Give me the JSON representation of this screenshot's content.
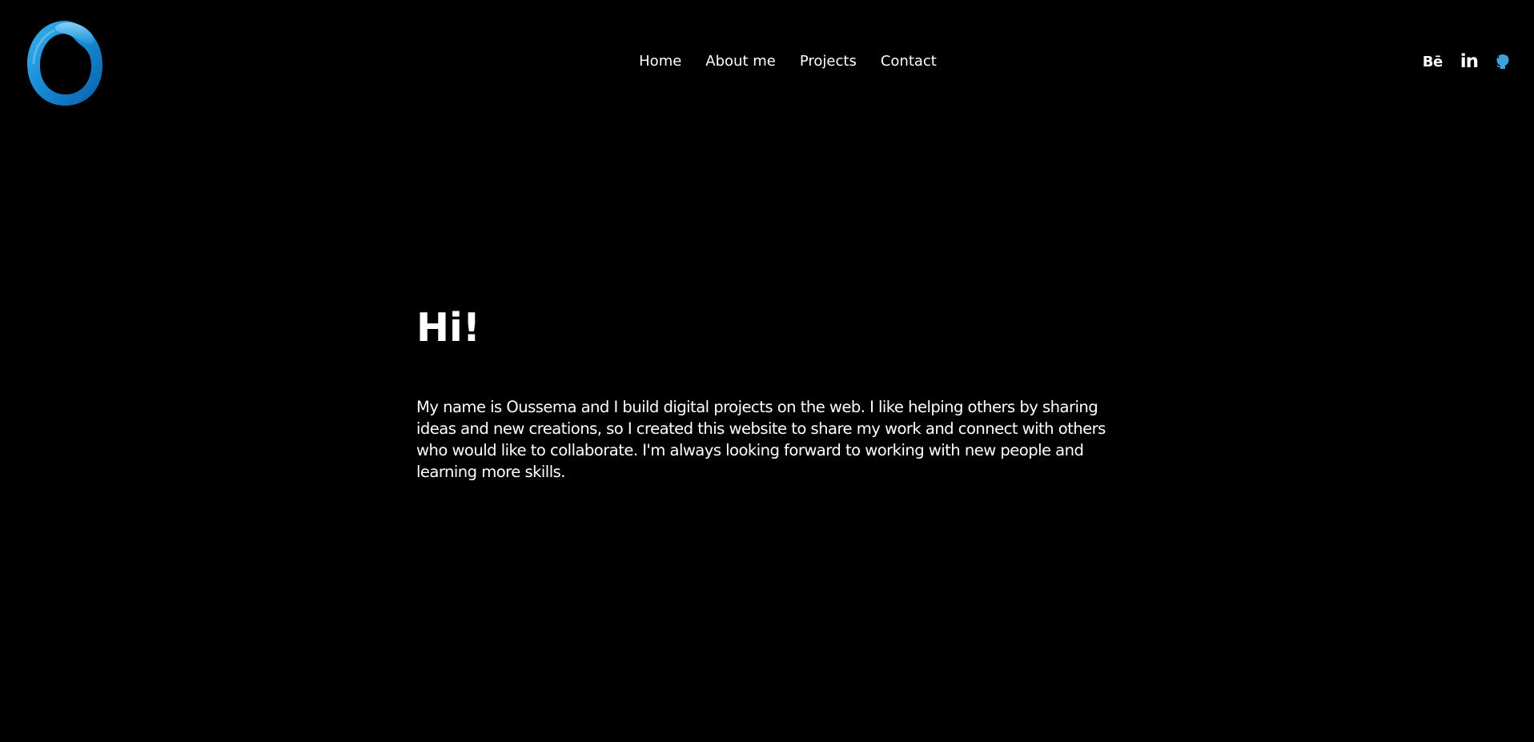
{
  "logo": {
    "icon": "o-ring-logo",
    "color": "#1a8fd6"
  },
  "nav": {
    "items": [
      {
        "label": "Home"
      },
      {
        "label": "About me"
      },
      {
        "label": "Projects"
      },
      {
        "label": "Contact"
      }
    ]
  },
  "socials": {
    "behance": {
      "label": "Bē",
      "icon": "behance-icon"
    },
    "linkedin": {
      "label": "in",
      "icon": "linkedin-icon"
    },
    "github": {
      "icon": "github-icon",
      "color": "#3fa2dd"
    }
  },
  "hero": {
    "title": "Hi!",
    "body": "My name is Oussema and I build digital projects on the web. I like helping others by sharing ideas and new creations, so I created this website to share my work and connect with others who would like to collaborate. I'm always looking forward to working with new people and learning more skills."
  }
}
